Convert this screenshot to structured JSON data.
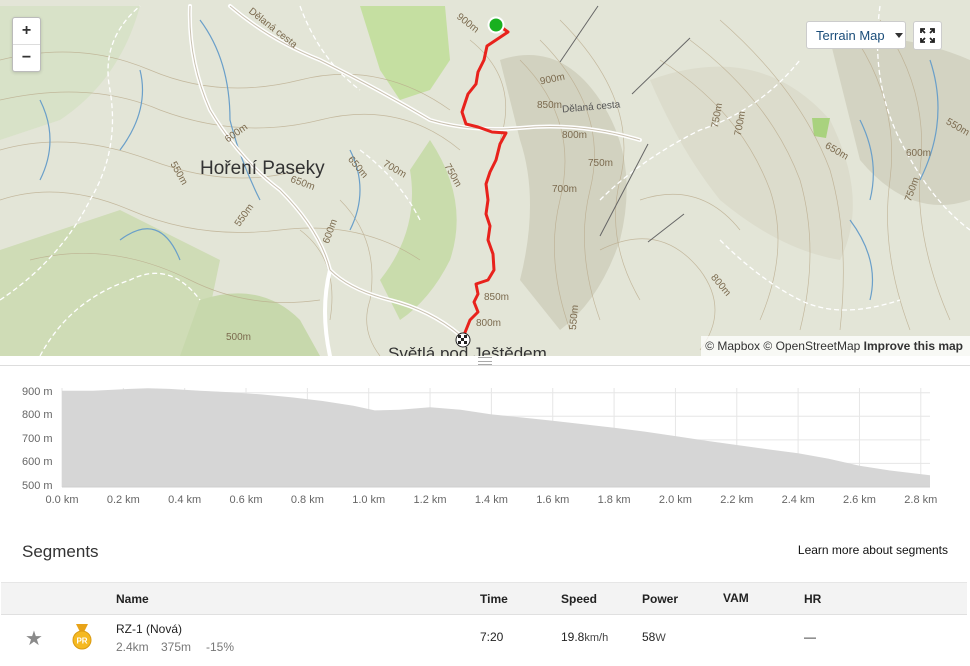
{
  "map": {
    "zoom_in": "+",
    "zoom_out": "−",
    "terrain_button": "Terrain Map",
    "attribution_mapbox": "© Mapbox",
    "attribution_osm": "© OpenStreetMap",
    "attribution_improve": "Improve this map",
    "places": {
      "horeni_paseky": "Hoření Paseky",
      "svetla": "Světlá pod Ještědem",
      "delana_cesta_1": "Dělaná cesta",
      "delana_cesta_2": "Dělaná cesta"
    },
    "contours": {
      "c1": "900m",
      "c2": "900m",
      "c3": "850m",
      "c4": "800m",
      "c5": "750m",
      "c6": "700m",
      "c7": "750m",
      "c8": "700m",
      "c9": "650m",
      "c10": "600m",
      "c11": "550m",
      "c12": "550m",
      "c13": "650m",
      "c14": "600m",
      "c15": "550m",
      "c16": "750m",
      "c17": "650m",
      "c18": "600m",
      "c19": "700m",
      "c20": "800m",
      "c21": "850m",
      "c22": "800m",
      "c23": "550m",
      "c24": "500m",
      "c25": "750m"
    },
    "colors": {
      "route": "#e8221c",
      "start": "#19b01f",
      "terrain_text": "#1a4d7a"
    }
  },
  "elevation": {
    "y_ticks": [
      "900 m",
      "800 m",
      "700 m",
      "600 m",
      "500 m"
    ],
    "x_ticks": [
      "0.0 km",
      "0.2 km",
      "0.4 km",
      "0.6 km",
      "0.8 km",
      "1.0 km",
      "1.2 km",
      "1.4 km",
      "1.6 km",
      "1.8 km",
      "2.0 km",
      "2.2 km",
      "2.4 km",
      "2.6 km",
      "2.8 km"
    ],
    "ylim": [
      500,
      920
    ],
    "xlim": [
      0,
      2.83
    ],
    "profile": [
      [
        0,
        908
      ],
      [
        0.1,
        908
      ],
      [
        0.2,
        915
      ],
      [
        0.28,
        919
      ],
      [
        0.35,
        916
      ],
      [
        0.45,
        908
      ],
      [
        0.55,
        902
      ],
      [
        0.65,
        893
      ],
      [
        0.75,
        880
      ],
      [
        0.85,
        865
      ],
      [
        0.95,
        845
      ],
      [
        1.02,
        825
      ],
      [
        1.1,
        828
      ],
      [
        1.2,
        838
      ],
      [
        1.3,
        828
      ],
      [
        1.4,
        808
      ],
      [
        1.5,
        795
      ],
      [
        1.6,
        781
      ],
      [
        1.7,
        766
      ],
      [
        1.8,
        751
      ],
      [
        1.9,
        735
      ],
      [
        2.0,
        716
      ],
      [
        2.1,
        696
      ],
      [
        2.2,
        678
      ],
      [
        2.3,
        660
      ],
      [
        2.4,
        643
      ],
      [
        2.5,
        620
      ],
      [
        2.6,
        590
      ],
      [
        2.7,
        570
      ],
      [
        2.83,
        550
      ]
    ]
  },
  "segments": {
    "title": "Segments",
    "learn_more": "Learn more about segments",
    "columns": {
      "name": "Name",
      "time": "Time",
      "speed": "Speed",
      "power": "Power",
      "vam": "VAM",
      "hr": "HR"
    },
    "rows": [
      {
        "name": "RZ-1 (Nová)",
        "distance": "2.4km",
        "elevation": "375m",
        "grade": "-15%",
        "time": "7:20",
        "speed_value": "19.8",
        "speed_unit": "km/h",
        "power_value": "58",
        "power_unit": "W",
        "vam": "",
        "hr": "—",
        "medal": "PR"
      }
    ]
  }
}
